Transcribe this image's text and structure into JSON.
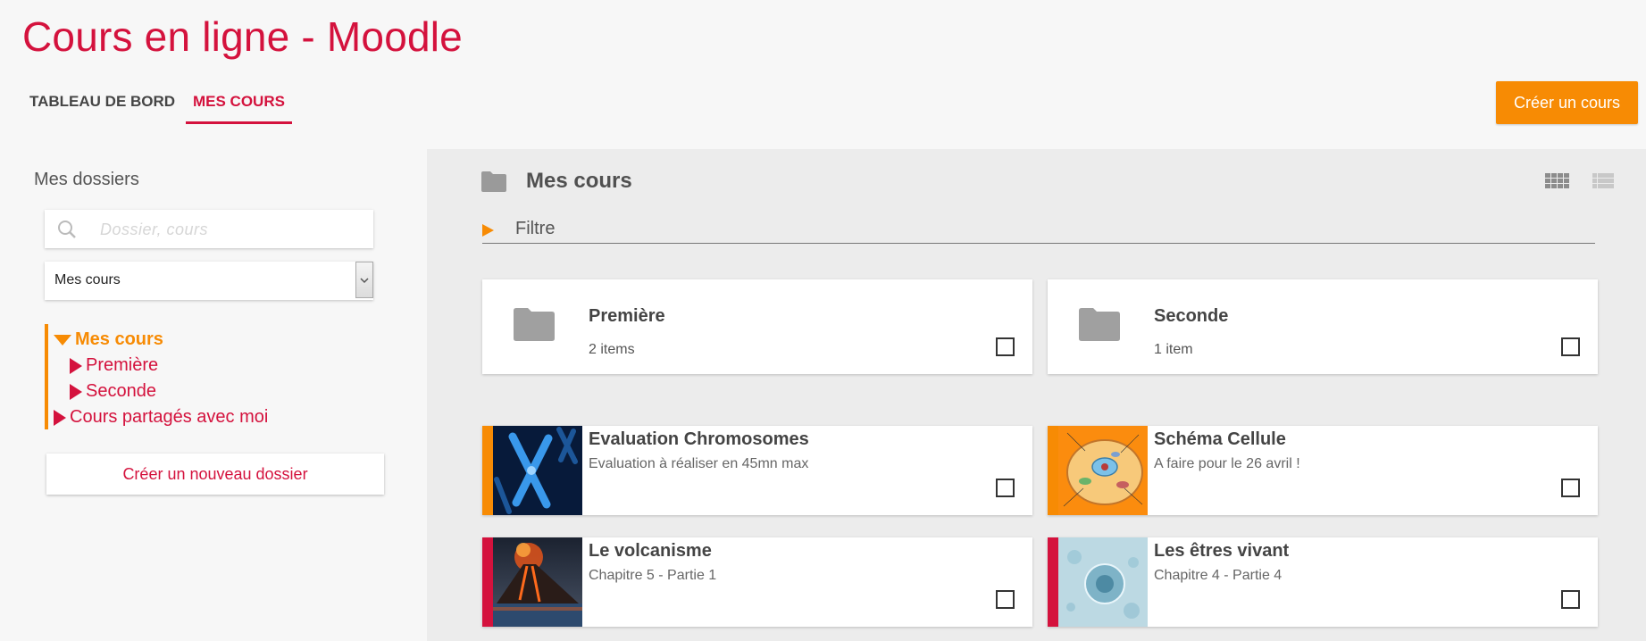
{
  "header": {
    "title": "Cours en ligne - Moodle",
    "tabs": [
      {
        "label": "TABLEAU DE BORD",
        "active": false
      },
      {
        "label": "MES COURS",
        "active": true
      }
    ],
    "create_course_label": "Créer un cours"
  },
  "sidebar": {
    "title": "Mes dossiers",
    "search_placeholder": "Dossier, cours",
    "select_value": "Mes cours",
    "tree": [
      {
        "label": "Mes cours",
        "expanded": true
      },
      {
        "label": "Première"
      },
      {
        "label": "Seconde"
      },
      {
        "label": "Cours partagés avec moi"
      }
    ],
    "new_folder_label": "Créer un nouveau dossier"
  },
  "main": {
    "title": "Mes cours",
    "filter_label": "Filtre",
    "folders": [
      {
        "name": "Première",
        "count": "2 items"
      },
      {
        "name": "Seconde",
        "count": "1 item"
      }
    ],
    "courses": [
      {
        "name": "Evaluation Chromosomes",
        "description": "Evaluation à réaliser en 45mn max",
        "stripe_color": "#f78b04",
        "thumb": "chromosomes-image"
      },
      {
        "name": "Schéma Cellule",
        "description": "A faire pour le 26 avril !",
        "stripe_color": "#f78b04",
        "thumb": "cell-diagram-image"
      },
      {
        "name": "Le volcanisme",
        "description": "Chapitre 5 - Partie 1",
        "stripe_color": "#d4123d",
        "thumb": "volcano-image"
      },
      {
        "name": "Les êtres vivant",
        "description": "Chapitre 4 - Partie 4",
        "stripe_color": "#d4123d",
        "thumb": "cell-microscope-image"
      }
    ]
  },
  "colors": {
    "brand_red": "#d4123d",
    "accent_orange": "#f78b04"
  }
}
